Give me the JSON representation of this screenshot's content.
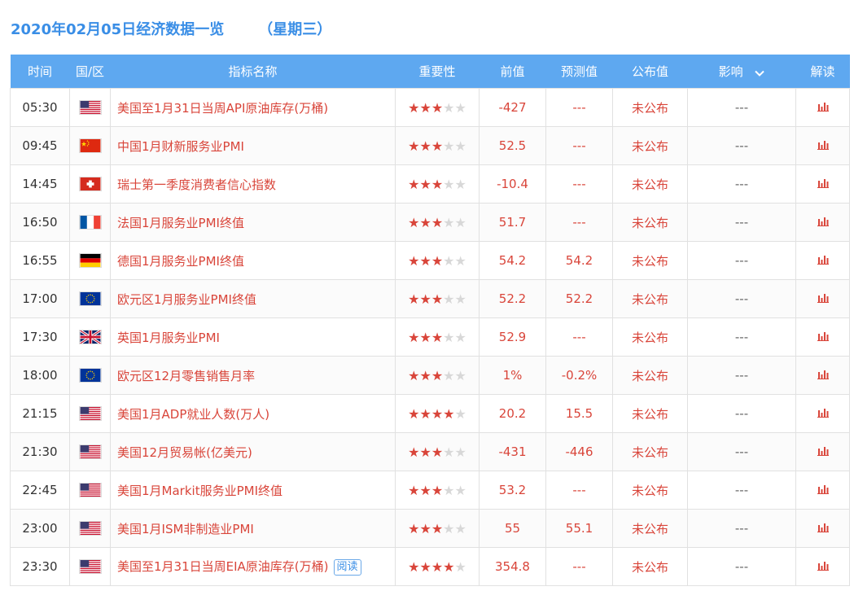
{
  "header": {
    "date_title": "2020年02月05日经济数据一览",
    "weekday": "（星期三）"
  },
  "columns": {
    "time": "时间",
    "region": "国/区",
    "indicator": "指标名称",
    "importance": "重要性",
    "previous": "前值",
    "forecast": "预测值",
    "actual": "公布值",
    "impact": "影响",
    "interpret": "解读"
  },
  "icons": {
    "impact_dropdown": "chevron-down-icon",
    "interpret": "bar-chart-icon",
    "flag": "flag-icon"
  },
  "colors": {
    "accent": "#5ea8f0",
    "highlight": "#d9453a"
  },
  "rows": [
    {
      "time": "05:30",
      "country": "us",
      "indicator": "美国至1月31日当周API原油库存(万桶)",
      "stars": 3,
      "previous": "-427",
      "forecast": "---",
      "actual": "未公布",
      "impact": "---"
    },
    {
      "time": "09:45",
      "country": "cn",
      "indicator": "中国1月财新服务业PMI",
      "stars": 3,
      "previous": "52.5",
      "forecast": "---",
      "actual": "未公布",
      "impact": "---"
    },
    {
      "time": "14:45",
      "country": "ch",
      "indicator": "瑞士第一季度消费者信心指数",
      "stars": 3,
      "previous": "-10.4",
      "forecast": "---",
      "actual": "未公布",
      "impact": "---"
    },
    {
      "time": "16:50",
      "country": "fr",
      "indicator": "法国1月服务业PMI终值",
      "stars": 3,
      "previous": "51.7",
      "forecast": "---",
      "actual": "未公布",
      "impact": "---"
    },
    {
      "time": "16:55",
      "country": "de",
      "indicator": "德国1月服务业PMI终值",
      "stars": 3,
      "previous": "54.2",
      "forecast": "54.2",
      "actual": "未公布",
      "impact": "---"
    },
    {
      "time": "17:00",
      "country": "eu",
      "indicator": "欧元区1月服务业PMI终值",
      "stars": 3,
      "previous": "52.2",
      "forecast": "52.2",
      "actual": "未公布",
      "impact": "---"
    },
    {
      "time": "17:30",
      "country": "gb",
      "indicator": "英国1月服务业PMI",
      "stars": 3,
      "previous": "52.9",
      "forecast": "---",
      "actual": "未公布",
      "impact": "---"
    },
    {
      "time": "18:00",
      "country": "eu",
      "indicator": "欧元区12月零售销售月率",
      "stars": 3,
      "previous": "1%",
      "forecast": "-0.2%",
      "actual": "未公布",
      "impact": "---"
    },
    {
      "time": "21:15",
      "country": "us",
      "indicator": "美国1月ADP就业人数(万人)",
      "stars": 4,
      "previous": "20.2",
      "forecast": "15.5",
      "actual": "未公布",
      "impact": "---"
    },
    {
      "time": "21:30",
      "country": "us",
      "indicator": "美国12月贸易帐(亿美元)",
      "stars": 3,
      "previous": "-431",
      "forecast": "-446",
      "actual": "未公布",
      "impact": "---"
    },
    {
      "time": "22:45",
      "country": "us",
      "indicator": "美国1月Markit服务业PMI终值",
      "stars": 3,
      "previous": "53.2",
      "forecast": "---",
      "actual": "未公布",
      "impact": "---"
    },
    {
      "time": "23:00",
      "country": "us",
      "indicator": "美国1月ISM非制造业PMI",
      "stars": 3,
      "previous": "55",
      "forecast": "55.1",
      "actual": "未公布",
      "impact": "---"
    },
    {
      "time": "23:30",
      "country": "us",
      "indicator": "美国至1月31日当周EIA原油库存(万桶)",
      "badge": "阅读",
      "stars": 4,
      "previous": "354.8",
      "forecast": "---",
      "actual": "未公布",
      "impact": "---"
    }
  ]
}
